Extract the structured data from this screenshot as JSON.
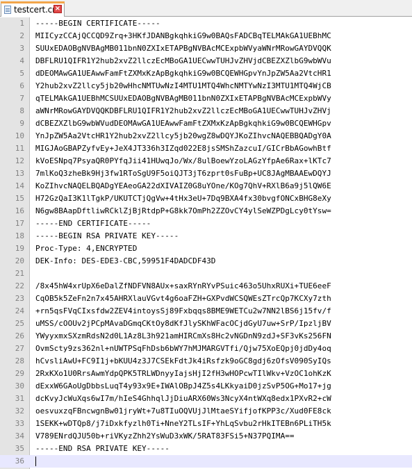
{
  "tab": {
    "title": "testcert.crt",
    "close_icon": "close-icon",
    "file_icon": "file-icon"
  },
  "colors": {
    "tab_accent": "#f2a54a",
    "current_line": "#e8e8ff",
    "gutter": "#e4e4e4"
  },
  "current_line_number": 36,
  "lines": [
    {
      "n": "1",
      "t": "-----BEGIN CERTIFICATE-----"
    },
    {
      "n": "2",
      "t": "MIICyzCCAjQCCQD9Zrq+3HKfJDANBgkqhkiG9w0BAQsFADCBqTELMAkGA1UEBhMC"
    },
    {
      "n": "3",
      "t": "SUUxEDAOBgNVBAgMB011bnN0ZXIxETAPBgNVBAcMCExpbWVyaWNrMRowGAYDVQQK"
    },
    {
      "n": "4",
      "t": "DBFLRU1QIFR1Y2hub2xvZ2llczEcMBoGA1UECwwTUHJvZHVjdCBEZXZlbG9wbWVu"
    },
    {
      "n": "5",
      "t": "dDEOMAwGA1UEAwwFamFtZXMxKzApBgkqhkiG9w0BCQEWHGpvYnJpZW5Aa2VtcHR1"
    },
    {
      "n": "6",
      "t": "Y2hub2xvZ2llcy5jb20wHhcNMTUwNzI4MTU1MTQ4WhcNMTYwNzI3MTU1MTQ4WjCB"
    },
    {
      "n": "7",
      "t": "qTELMAkGA1UEBhMCSUUxEDAOBgNVBAgMB011bnN0ZXIxETAPBgNVBAcMCExpbWVy"
    },
    {
      "n": "8",
      "t": "aWNrMRowGAYDVQQKDBFLRU1QIFR1Y2hub2xvZ2llczEcMBoGA1UECwwTUHJvZHVj"
    },
    {
      "n": "9",
      "t": "dCBEZXZlbG9wbWVudDEOMAwGA1UEAwwFamFtZXMxKzApBgkqhkiG9w0BCQEWHGpv"
    },
    {
      "n": "10",
      "t": "YnJpZW5Aa2VtcHR1Y2hub2xvZ2llcy5jb20wgZ8wDQYJKoZIhvcNAQEBBQADgY0A"
    },
    {
      "n": "11",
      "t": "MIGJAoGBAPZyfvEy+JeX4JT336h3IZqd022E8jsSMShZazcuI/GICrBbAGowhBtf"
    },
    {
      "n": "12",
      "t": "kVoESNpq7PsyaQR0PYfqJii41HUwqJo/Wx/8ulBoewYzoLAGzYfpAe6Rax+lKTc7"
    },
    {
      "n": "13",
      "t": "7mlKoQ3zheBk9Hj3fw1RToSgU9F5oiQJT3jT6zprt0sFuBp+UC8JAgMBAAEwDQYJ"
    },
    {
      "n": "14",
      "t": "KoZIhvcNAQELBQADgYEAeoGA22dXIVAIZ0G8uYOne/KOg7QhV+RXlB6a9j5lQW6E"
    },
    {
      "n": "15",
      "t": "H72GzQaI3K1lTgkP/UKUTCTjQgVw+4tHx3eU+7Dq9BXA4fx30bvgfONCxBHG8eXy"
    },
    {
      "n": "16",
      "t": "N6gw8BAapDftliwRCklZjBjRtdpP+G8kk7OmPh2ZZOvCY4ylSeWZPDgLcy0tYsw="
    },
    {
      "n": "17",
      "t": "-----END CERTIFICATE-----"
    },
    {
      "n": "18",
      "t": "-----BEGIN RSA PRIVATE KEY-----"
    },
    {
      "n": "19",
      "t": "Proc-Type: 4,ENCRYPTED"
    },
    {
      "n": "20",
      "t": "DEK-Info: DES-EDE3-CBC,59951F4DADCDF43D"
    },
    {
      "n": "21",
      "t": ""
    },
    {
      "n": "22",
      "t": "/8x45hW4xrUpX6eDalZfNDFVN8AUx+saxRYnRYvPSuic463o5UhxRUXi+TUE6eeF"
    },
    {
      "n": "23",
      "t": "CqOB5k5ZeFn2n7x45AHRXlauVGvt4g6oaFZH+GXPvdWCSQWEsZTrcQp7KCXy7zth"
    },
    {
      "n": "24",
      "t": "+rn5qsFVqCIxsfdw2ZEV4intoysSj89Fxbqqs8BME9WETCu2w7NN2lBS6j15fv/f"
    },
    {
      "n": "25",
      "t": "uMSS/cOOUv2jPCpMAvaDGmqCKtOy8dKfJlySKhWFacOCjdGyU7uw+SrP/IpzljBV"
    },
    {
      "n": "26",
      "t": "YWyyxmxSXzmRdsN2d0L1Az8L3h921amHIRCmXs8Hc2vNGDnN9zdJ+SF3vKs256FN"
    },
    {
      "n": "27",
      "t": "OvmScty9zs362nl+nUWTPSqFhDsb6bWY7hMJMARGVTfi/Qjw75XoEQpj0jdDy4oq"
    },
    {
      "n": "28",
      "t": "hCvsliAwU+FC9I1j+bKUU4z3J7CSEkFdtJk4iRsfzk9oGC8gdj6zOfsV090SyIQs"
    },
    {
      "n": "29",
      "t": "2RxKXo1U0RrsAwmYdpQPK5TRLWDnyyIajsHjI2fH3wHOPcwTIlWkv+VzOC1ohKzK"
    },
    {
      "n": "30",
      "t": "dExxW6GAoUgDbbsLuqT4y93x9E+IWAlOBpJ4Z5s4LKkyaiD0jzSvP5OG+Mo17+jg"
    },
    {
      "n": "31",
      "t": "dcKvyJcWuXqs6wI7m/hIeS4GhhqlJjDiuARX60Ws3NcyX4ntWXq8edx1PXvR2+cW"
    },
    {
      "n": "32",
      "t": "oesvuxzqFBncwgnBw01jryWt+7u8TIuOQVUjJlMtaeSYifjofKPP3c/Xud0FE8ck"
    },
    {
      "n": "33",
      "t": "1SEKK+wDTQp8/j7iDxkfyzlh0Ti+NneY2TLsIF+YhLqSvbu2rHkITEBn6PLiTH5k"
    },
    {
      "n": "34",
      "t": "V789ENrdQJU50b+riVKyzZhh2YsWuD3xWK/5RAT83FSi5+N37PQIMA=="
    },
    {
      "n": "35",
      "t": "-----END RSA PRIVATE KEY-----"
    },
    {
      "n": "36",
      "t": ""
    }
  ]
}
